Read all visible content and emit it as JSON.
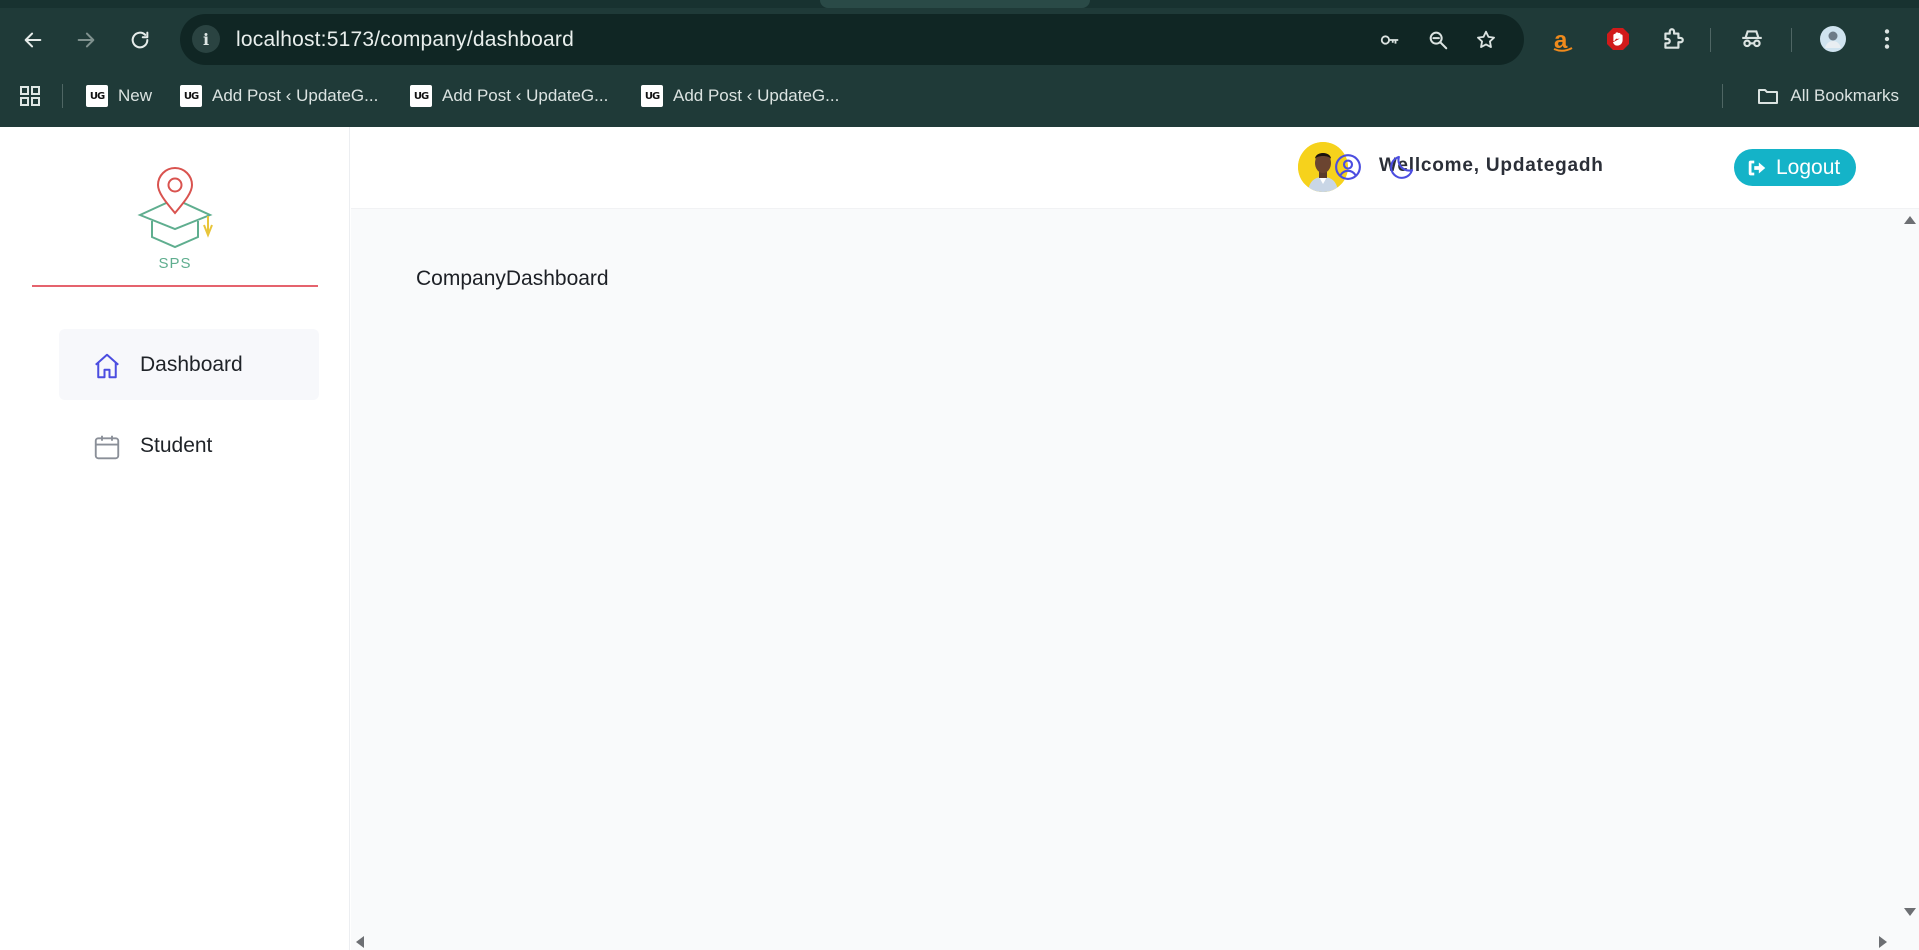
{
  "browser": {
    "url": "localhost:5173/company/dashboard",
    "bookmarks": [
      {
        "label": "New",
        "favicon": "UG"
      },
      {
        "label": "Add Post ‹ UpdateG...",
        "favicon": "UG"
      },
      {
        "label": "Add Post ‹ UpdateG...",
        "favicon": "UG"
      },
      {
        "label": "Add Post ‹ UpdateG...",
        "favicon": "UG"
      }
    ],
    "all_bookmarks_label": "All Bookmarks"
  },
  "logo": {
    "text": "SPS"
  },
  "sidebar": {
    "items": [
      {
        "label": "Dashboard",
        "icon": "home-icon",
        "active": true
      },
      {
        "label": "Student",
        "icon": "calendar-icon",
        "active": false
      }
    ]
  },
  "header": {
    "welcome": "Wellcome, Updategadh",
    "logout_label": "Logout"
  },
  "main": {
    "heading": "CompanyDashboard"
  },
  "colors": {
    "chrome_bg": "#1f3a38",
    "accent": "#4b4de0",
    "logout_bg": "#14b3c8",
    "logo_divider": "#e5636d"
  }
}
